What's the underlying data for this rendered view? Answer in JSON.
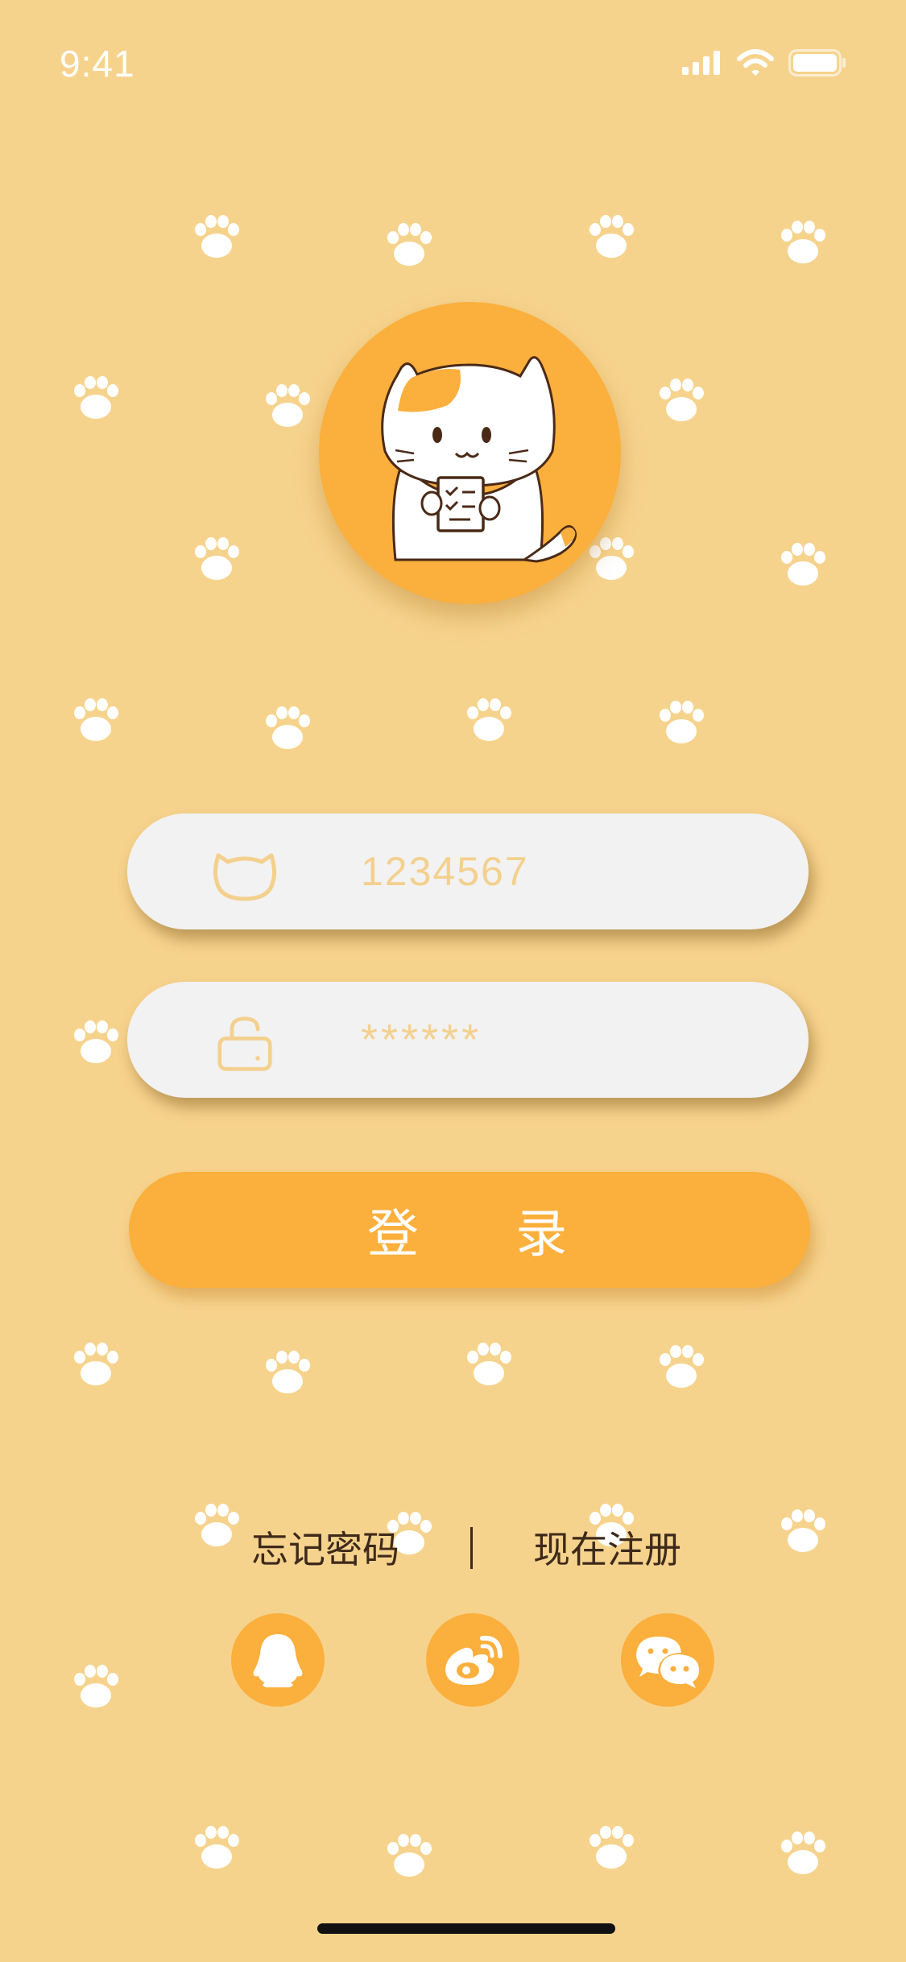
{
  "status_bar": {
    "time": "9:41"
  },
  "login_form": {
    "username": {
      "value": "1234567",
      "icon": "cat-head-icon"
    },
    "password": {
      "value": "******",
      "icon": "lock-icon"
    },
    "login_label": "登 录"
  },
  "links": {
    "forgot_password": "忘记密码",
    "divider": "|",
    "register": "现在注册"
  },
  "social": [
    {
      "name": "qq",
      "icon": "qq-icon"
    },
    {
      "name": "weibo",
      "icon": "weibo-icon"
    },
    {
      "name": "wechat",
      "icon": "wechat-icon"
    }
  ],
  "colors": {
    "background": "#F6D38D",
    "accent": "#FBAF3C",
    "field": "#F2F2F2",
    "text_dark": "#3E2A1B",
    "placeholder": "#F3D08E"
  }
}
